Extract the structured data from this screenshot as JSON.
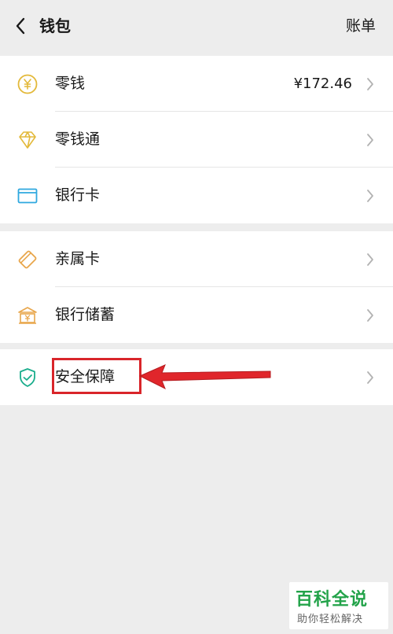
{
  "header": {
    "title": "钱包",
    "right_link": "账单"
  },
  "groups": [
    {
      "items": [
        {
          "label": "零钱",
          "value": "¥172.46",
          "icon": "yuan-coin-icon"
        },
        {
          "label": "零钱通",
          "icon": "diamond-icon"
        },
        {
          "label": "银行卡",
          "icon": "bank-card-icon"
        }
      ]
    },
    {
      "items": [
        {
          "label": "亲属卡",
          "icon": "family-card-icon"
        },
        {
          "label": "银行储蓄",
          "icon": "bank-savings-icon"
        }
      ]
    },
    {
      "items": [
        {
          "label": "安全保障",
          "icon": "shield-check-icon"
        }
      ]
    }
  ],
  "colors": {
    "background": "#ededed",
    "icon_gold": "#e3b93a",
    "icon_blue": "#2fa8df",
    "icon_orange": "#e8a64b",
    "icon_green": "#1aad8c",
    "annotation_red": "#d9252a"
  },
  "watermark": {
    "title": "百科全说",
    "subtitle": "助你轻松解决"
  }
}
